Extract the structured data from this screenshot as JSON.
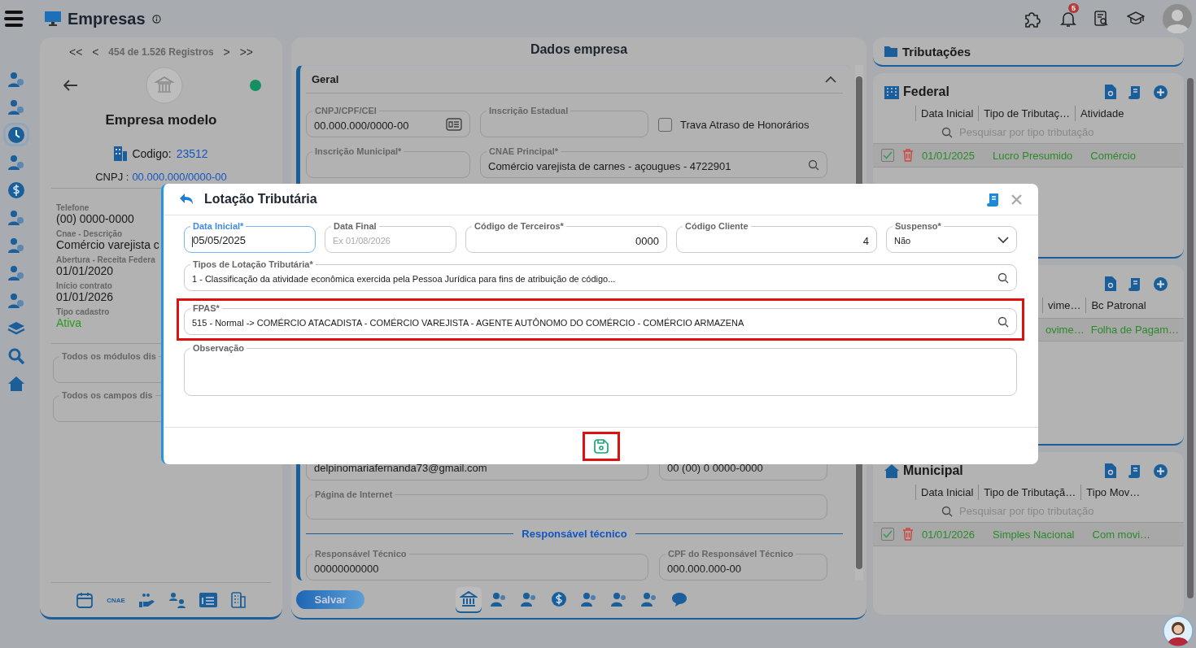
{
  "header": {
    "title": "Empresas",
    "notification_count": "5"
  },
  "record_nav": {
    "first": "<<",
    "prev": "<",
    "position": "454 de 1.526 Registros",
    "next": ">",
    "last": ">>"
  },
  "company": {
    "name": "Empresa modelo",
    "active": true,
    "code_label": "Codigo:",
    "code": "23512",
    "cnpj_label": "CNPJ :",
    "cnpj": "00.000.000/0000-00"
  },
  "details": [
    {
      "label": "Telefone",
      "value": "(00) 0000-0000",
      "kind": "plain"
    },
    {
      "label": "Cnae - Descrição",
      "value": "Comércio varejista c",
      "kind": "plain"
    },
    {
      "label": "Abertura - Receita Federa",
      "value": "01/01/2020",
      "kind": "plain"
    },
    {
      "label": "Início contrato",
      "value": "01/01/2026",
      "kind": "plain"
    },
    {
      "label": "Tipo cadastro",
      "value": "Ativa",
      "kind": "status"
    }
  ],
  "left_fields": [
    {
      "label": "Todos os módulos dis"
    },
    {
      "label": "Todos os campos dis"
    }
  ],
  "left_footer": {
    "cnae_label": "CNAE"
  },
  "dados": {
    "title": "Dados empresa",
    "section_title": "Geral",
    "expanded": true,
    "cnpj_field": {
      "label": "CNPJ/CPF/CEI",
      "value": "00.000.000/0000-00"
    },
    "ie_field": {
      "label": "Inscrição Estadual"
    },
    "checkbox": {
      "label": "Trava Atraso de Honorários",
      "checked": false
    },
    "im_field": {
      "label": "Inscrição Municipal*"
    },
    "cnae_field": {
      "label": "CNAE Principal*",
      "value": "Comércio varejista de carnes - açougues - 4722901"
    },
    "email_value": "delpinomariafernanda73@gmail.com",
    "phone_value": "00 (00) 0 0000-0000",
    "site_field": {
      "label": "Página de Internet"
    },
    "divider": "Responsável técnico",
    "resp_field": {
      "label": "Responsável Técnico",
      "value": "00000000000"
    },
    "resp_cpf_field": {
      "label": "CPF do Responsável Técnico",
      "value": "000.000.000-00"
    },
    "save": "Salvar",
    "tabs": [
      {
        "selected": true
      },
      {
        "selected": false
      },
      {
        "selected": false
      },
      {
        "selected": false
      },
      {
        "selected": false
      },
      {
        "selected": false
      },
      {
        "selected": false
      },
      {
        "selected": false
      }
    ]
  },
  "tributacoes": {
    "title": "Tributações",
    "cards": [
      {
        "kind": "federal",
        "title": "Federal",
        "columns": [
          "Data Inicial",
          "Tipo de Tributaç…",
          "Atividade"
        ],
        "search_placeholder": "Pesquisar por tipo tributação",
        "rows": [
          {
            "checked": true,
            "cells": [
              "01/01/2025",
              "Lucro Presumido",
              "Comércio"
            ]
          }
        ]
      },
      {
        "kind": "covered",
        "columns": [
          "vime…",
          "Bc Patronal"
        ],
        "rows": [
          {
            "cells": [
              "ovime…",
              "Folha de Pagam…"
            ]
          }
        ]
      },
      {
        "kind": "municipal",
        "title": "Municipal",
        "columns": [
          "Data Inicial",
          "Tipo de Tributaçã…",
          "Tipo Mov…"
        ],
        "search_placeholder": "Pesquisar por tipo tributação",
        "rows": [
          {
            "checked": true,
            "cells": [
              "01/01/2026",
              "Simples Nacional",
              "Com movi…"
            ]
          }
        ]
      }
    ]
  },
  "modal": {
    "title": "Lotação Tributária",
    "fields": [
      {
        "label": "Data Inicial*",
        "value": "05/05/2025",
        "focused": true,
        "kind": "text"
      },
      {
        "label": "Data Final",
        "placeholder": "Ex 01/08/2026",
        "focused": false,
        "kind": "text"
      },
      {
        "label": "Código de Terceiros*",
        "value": "0000",
        "focused": false,
        "kind": "number"
      },
      {
        "label": "Código Cliente",
        "value": "4",
        "focused": false,
        "kind": "number"
      },
      {
        "label": "Suspenso*",
        "value": "Não",
        "focused": false,
        "kind": "select"
      }
    ],
    "lookups": [
      {
        "label": "Tipos de Lotação Tributária*",
        "value": "1 - Classificação da atividade econômica exercida pela Pessoa Jurídica para fins de atribuição de código...",
        "highlighted": false
      },
      {
        "label": "FPAS*",
        "value": "515 - Normal -> COMÉRCIO ATACADISTA - COMÉRCIO VAREJISTA - AGENTE AUTÔNOMO DO COMÉRCIO - COMÉRCIO ARMAZENA",
        "highlighted": true
      }
    ],
    "note_label": "Observação",
    "save_highlighted": true
  }
}
